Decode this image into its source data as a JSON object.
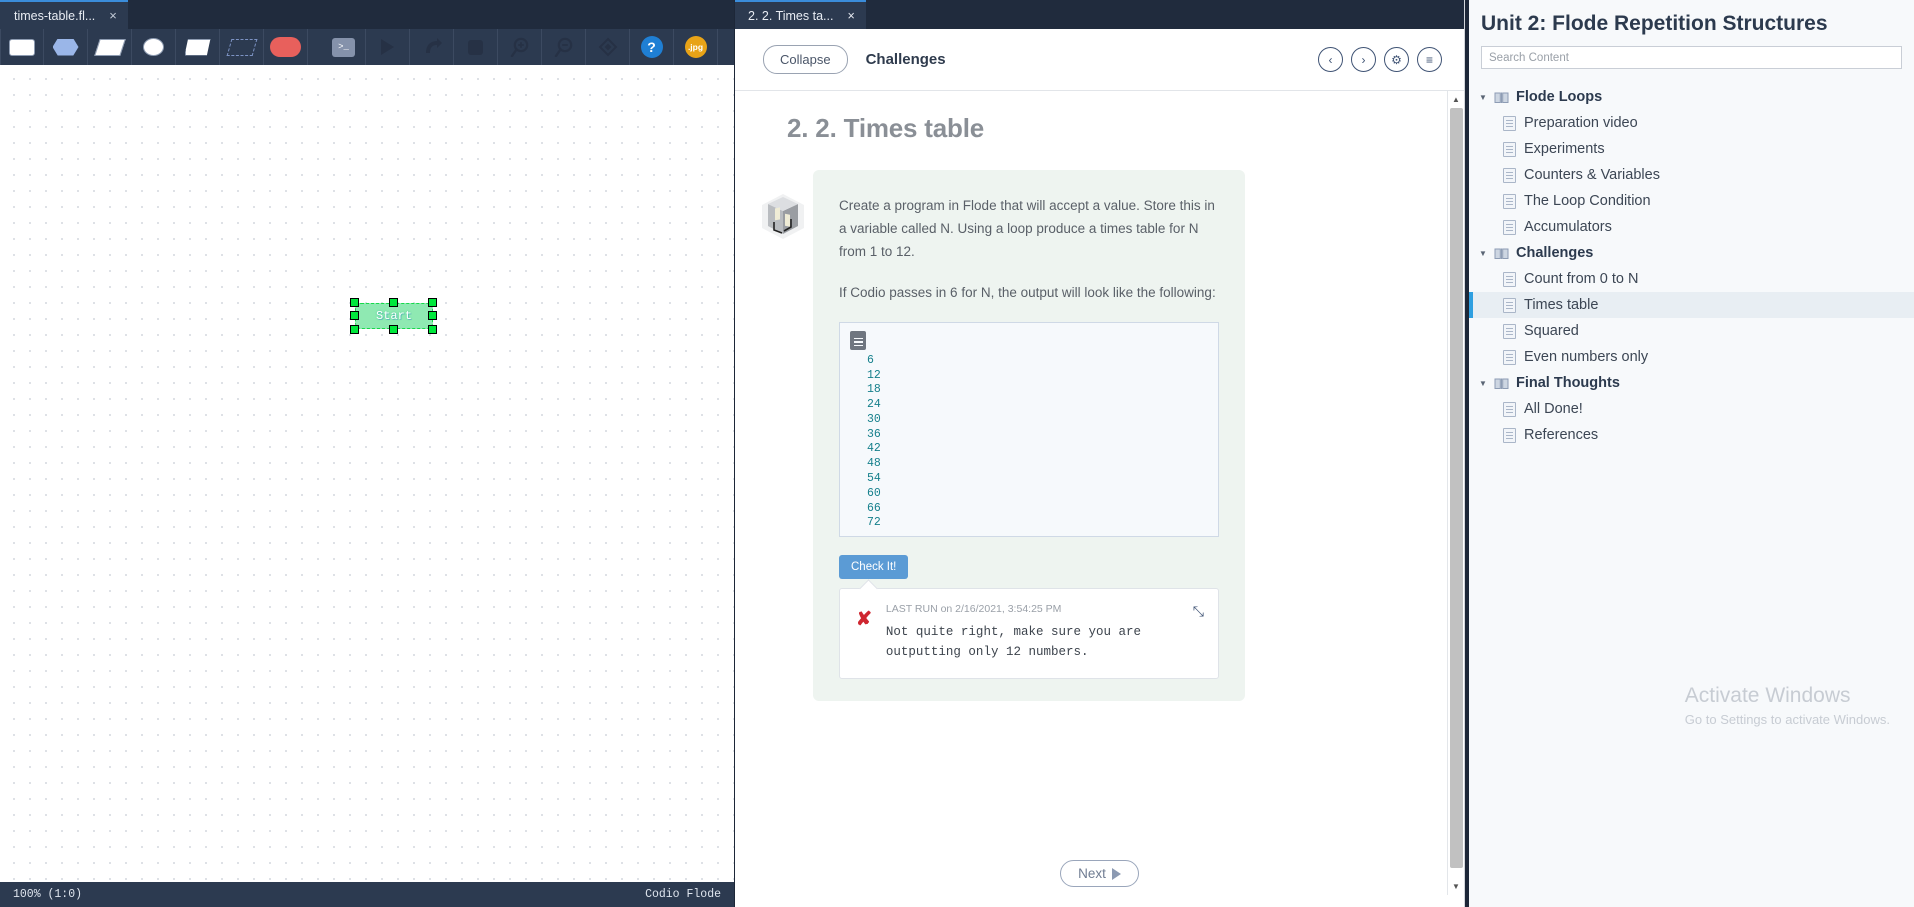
{
  "flode": {
    "tab": {
      "label": "times-table.fl...",
      "close": "×"
    },
    "toolbar": [
      {
        "name": "rect-shape-tool",
        "label": ""
      },
      {
        "name": "hexagon-shape-tool",
        "label": ""
      },
      {
        "name": "parallelogram-shape-tool",
        "label": ""
      },
      {
        "name": "ellipse-shape-tool",
        "label": ""
      },
      {
        "name": "trapezoid-shape-tool",
        "label": ""
      },
      {
        "name": "dashed-parallelogram-shape-tool",
        "label": ""
      },
      {
        "name": "pill-shape-tool",
        "label": ""
      },
      {
        "name": "terminal-tool",
        "label": ">_"
      },
      {
        "name": "run-tool",
        "label": ""
      },
      {
        "name": "step-tool",
        "label": ""
      },
      {
        "name": "stop-tool",
        "label": ""
      },
      {
        "name": "zoom-in-tool",
        "label": ""
      },
      {
        "name": "zoom-out-tool",
        "label": ""
      },
      {
        "name": "reset-zoom-tool",
        "label": ""
      },
      {
        "name": "help-tool",
        "label": "?"
      },
      {
        "name": "avatar-tool",
        "label": ".jpg"
      }
    ],
    "canvas": {
      "node_label": "Start"
    },
    "status": {
      "zoom": "100% (1:0)",
      "product": "Codio Flode"
    }
  },
  "guide": {
    "tab": {
      "label": "2. 2. Times ta...",
      "close": "×"
    },
    "collapse_label": "Collapse",
    "section_title": "Challenges",
    "head_icons": [
      {
        "name": "prev-page-button",
        "glyph": "‹"
      },
      {
        "name": "next-page-button",
        "glyph": "›"
      },
      {
        "name": "settings-button",
        "glyph": "⚙"
      },
      {
        "name": "table-of-contents-button",
        "glyph": "≡"
      }
    ],
    "lesson_title": "2. 2. Times table",
    "brief_paragraphs": [
      "Create a program in Flode that will accept a value. Store this in a variable called N. Using a loop produce a times table for N from 1 to 12.",
      "If Codio passes in 6 for N, the output will look like the following:"
    ],
    "output_lines": [
      "6",
      "12",
      "18",
      "24",
      "30",
      "36",
      "42",
      "48",
      "54",
      "60",
      "66",
      "72"
    ],
    "check_label": "Check It!",
    "result": {
      "status_glyph": "✘",
      "last_run": "LAST RUN on 2/16/2021, 3:54:25 PM",
      "message": "Not quite right, make sure you are outputting only 12 numbers.",
      "expand_glyph": "⤡"
    },
    "next_label": "Next",
    "scroll": {
      "up": "▲",
      "down": "▼"
    }
  },
  "course": {
    "title": "Unit 2: Flode Repetition Structures",
    "search_placeholder": "Search Content",
    "tree": [
      {
        "type": "section",
        "label": "Flode Loops",
        "caret": "▼"
      },
      {
        "type": "item",
        "label": "Preparation video"
      },
      {
        "type": "item",
        "label": "Experiments"
      },
      {
        "type": "item",
        "label": "Counters & Variables"
      },
      {
        "type": "item",
        "label": "The Loop Condition"
      },
      {
        "type": "item",
        "label": "Accumulators"
      },
      {
        "type": "section",
        "label": "Challenges",
        "caret": "▼"
      },
      {
        "type": "item",
        "label": "Count from 0 to N"
      },
      {
        "type": "item",
        "label": "Times table",
        "selected": true
      },
      {
        "type": "item",
        "label": "Squared"
      },
      {
        "type": "item",
        "label": "Even numbers only"
      },
      {
        "type": "section",
        "label": "Final Thoughts",
        "caret": "▼"
      },
      {
        "type": "item",
        "label": "All Done!"
      },
      {
        "type": "item",
        "label": "References"
      }
    ]
  },
  "watermark": {
    "line1": "Activate Windows",
    "line2": "Go to Settings to activate Windows."
  },
  "colors": {
    "accent": "#2f9fe0",
    "check_button": "#5b9bd5",
    "error": "#cf2630",
    "output_text": "#16808c",
    "node_fill": "#8fe9b2",
    "chrome": "#2c3a50"
  }
}
